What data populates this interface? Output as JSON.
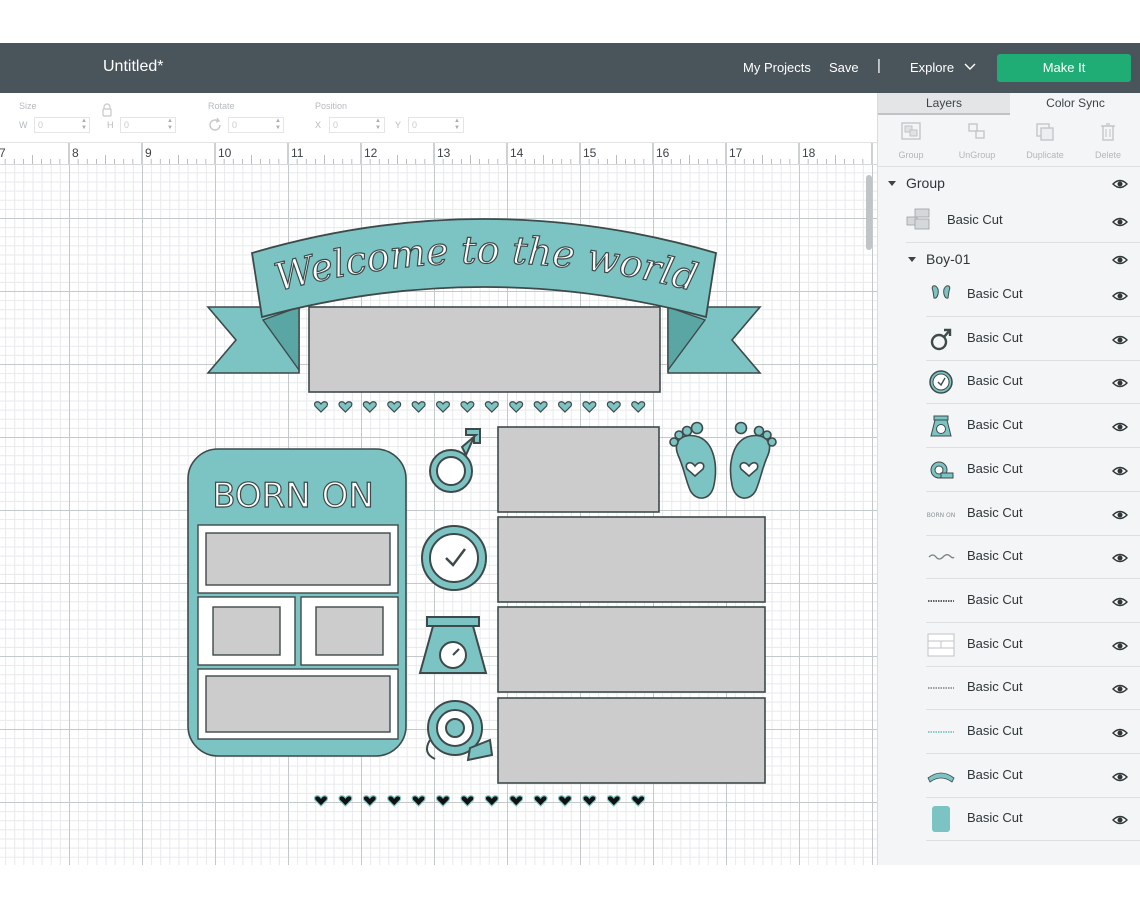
{
  "header": {
    "doc_title": "Untitled*",
    "nav": {
      "my_projects": "My Projects",
      "save": "Save",
      "separator": "|",
      "explore": "Explore"
    },
    "make_it": "Make It",
    "colors": {
      "bar": "#4a545b",
      "make_it": "#1fad75"
    }
  },
  "toolbar": {
    "size_label": "Size",
    "w_label": "W",
    "w_value": "0",
    "h_label": "H",
    "h_value": "0",
    "rotate_label": "Rotate",
    "rotate_value": "0",
    "position_label": "Position",
    "x_label": "X",
    "x_value": "0",
    "y_label": "Y",
    "y_value": "0"
  },
  "ruler": {
    "ticks": [
      "7",
      "8",
      "9",
      "10",
      "11",
      "12",
      "13",
      "14",
      "15",
      "16",
      "17",
      "18"
    ]
  },
  "design": {
    "banner_text": "Welcome to the world",
    "born_on": "BORN ON",
    "accent_color": "#7cc4c3",
    "outline_color": "#3e4a4a",
    "box_color": "#cccccc"
  },
  "panel": {
    "tabs": [
      "Layers",
      "Color Sync"
    ],
    "actions": [
      "Group",
      "UnGroup",
      "Duplicate",
      "Delete"
    ],
    "group": {
      "name": "Group",
      "basic_cut": "Basic Cut"
    },
    "subgroup": {
      "name": "Boy-01"
    },
    "layers": [
      {
        "name": "Basic Cut",
        "icon": "baby-feet-icon"
      },
      {
        "name": "Basic Cut",
        "icon": "male-symbol-icon"
      },
      {
        "name": "Basic Cut",
        "icon": "clock-icon"
      },
      {
        "name": "Basic Cut",
        "icon": "scale-icon"
      },
      {
        "name": "Basic Cut",
        "icon": "tape-measure-icon"
      },
      {
        "name": "Basic Cut",
        "icon": "born-on-text-icon"
      },
      {
        "name": "Basic Cut",
        "icon": "script-text-icon"
      },
      {
        "name": "Basic Cut",
        "icon": "dotted-line-icon"
      },
      {
        "name": "Basic Cut",
        "icon": "boxes-icon"
      },
      {
        "name": "Basic Cut",
        "icon": "hearts-row-icon"
      },
      {
        "name": "Basic Cut",
        "icon": "hearts-row-teal-icon"
      },
      {
        "name": "Basic Cut",
        "icon": "banner-icon"
      },
      {
        "name": "Basic Cut",
        "icon": "teal-rect-icon"
      }
    ]
  }
}
